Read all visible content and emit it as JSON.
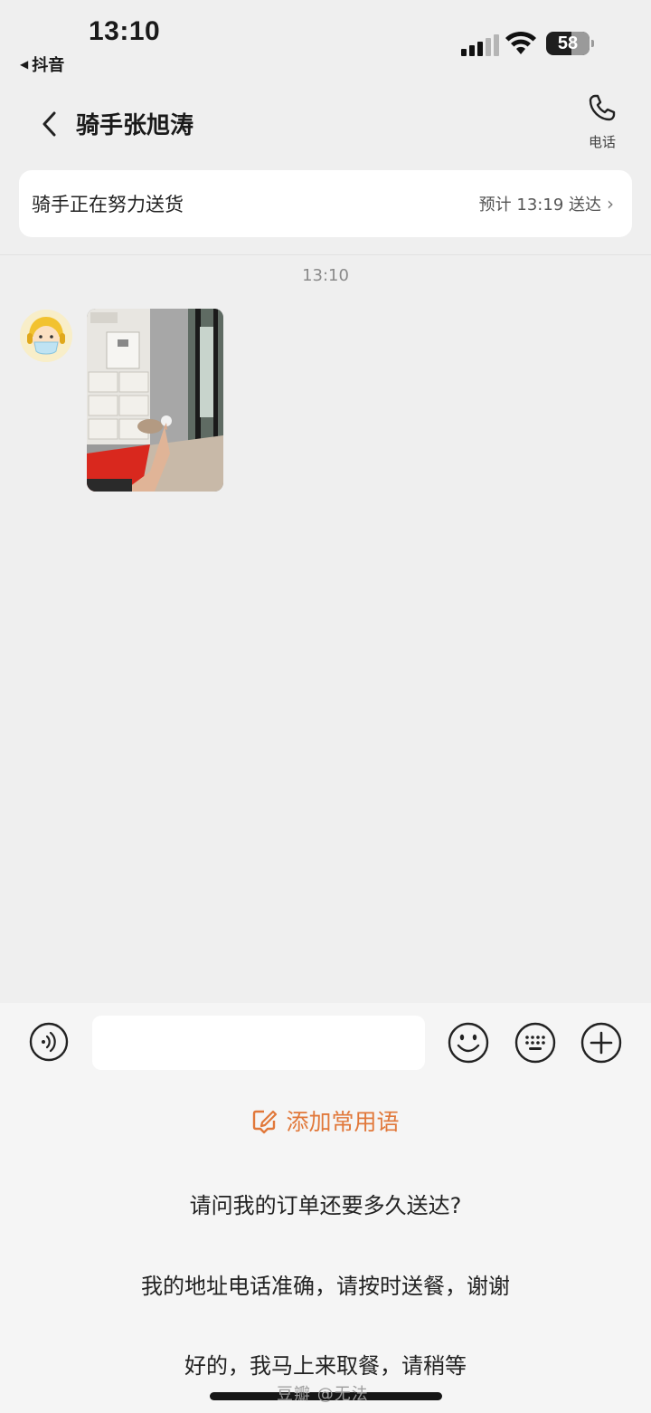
{
  "status_bar": {
    "time": "13:10",
    "back_app": "抖音",
    "battery": "58"
  },
  "header": {
    "title": "骑手张旭涛",
    "phone_label": "电话"
  },
  "delivery": {
    "status": "骑手正在努力送货",
    "eta": "预计 13:19 送达"
  },
  "messages": {
    "time": "13:10"
  },
  "input": {
    "placeholder": ""
  },
  "quick_phrases": {
    "add_label": "添加常用语",
    "items": [
      "请问我的订单还要多久送达?",
      "我的地址电话准确，请按时送餐，谢谢",
      "好的，我马上来取餐，请稍等"
    ]
  },
  "watermark": "豆瓣 @无法",
  "colors": {
    "accent": "#e1783a",
    "background": "#efefef"
  }
}
